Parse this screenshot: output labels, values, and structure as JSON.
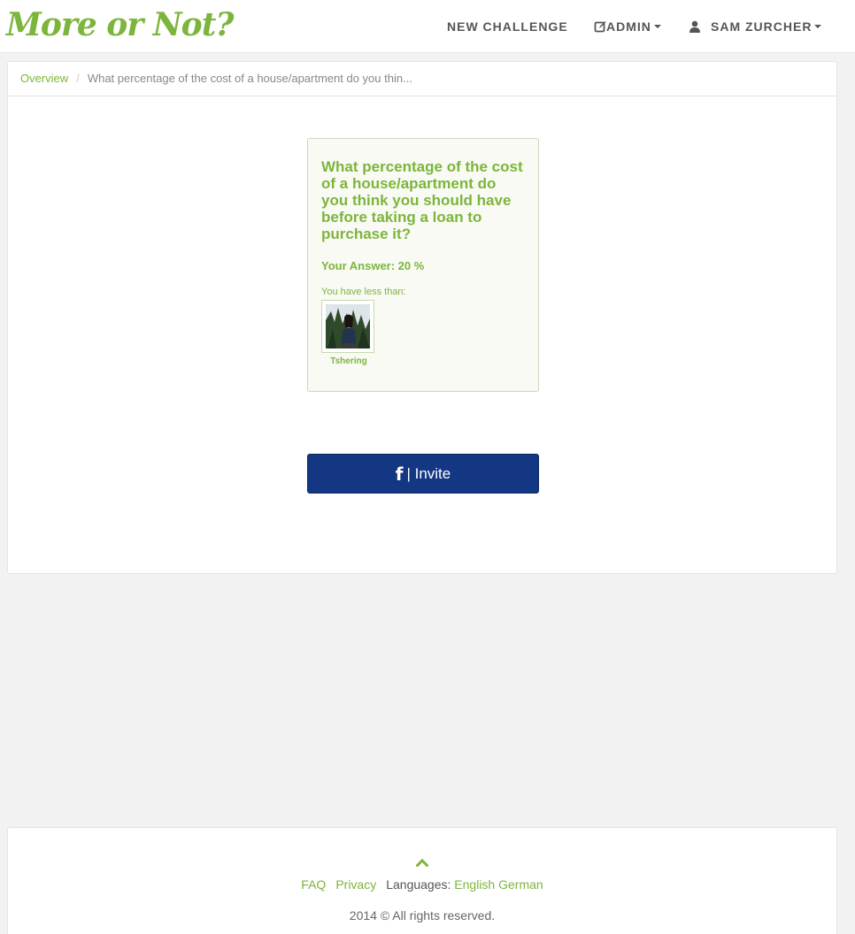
{
  "brand": {
    "logo": "More or Not?"
  },
  "nav": {
    "new_challenge": "NEW CHALLENGE",
    "admin": "ADMIN",
    "user": "SAM ZURCHER"
  },
  "breadcrumb": {
    "overview": "Overview",
    "separator": "/",
    "current": "What percentage of the cost of a house/apartment do you thin..."
  },
  "card": {
    "question": "What percentage of the cost of a house/apartment do you think you should have before taking a loan to purchase it?",
    "your_answer": "Your Answer: 20 %",
    "less_than_label": "You have less than:",
    "friends": [
      {
        "name": "Tshering"
      }
    ]
  },
  "invite": {
    "icon": "f",
    "label": "| Invite"
  },
  "footer": {
    "faq": "FAQ",
    "privacy": "Privacy",
    "languages_label": "Languages:",
    "lang_english": "English",
    "lang_german": "German",
    "copyright": "2014 © All rights reserved."
  },
  "colors": {
    "brand_green": "#7cb53b",
    "facebook_blue": "#133783"
  }
}
